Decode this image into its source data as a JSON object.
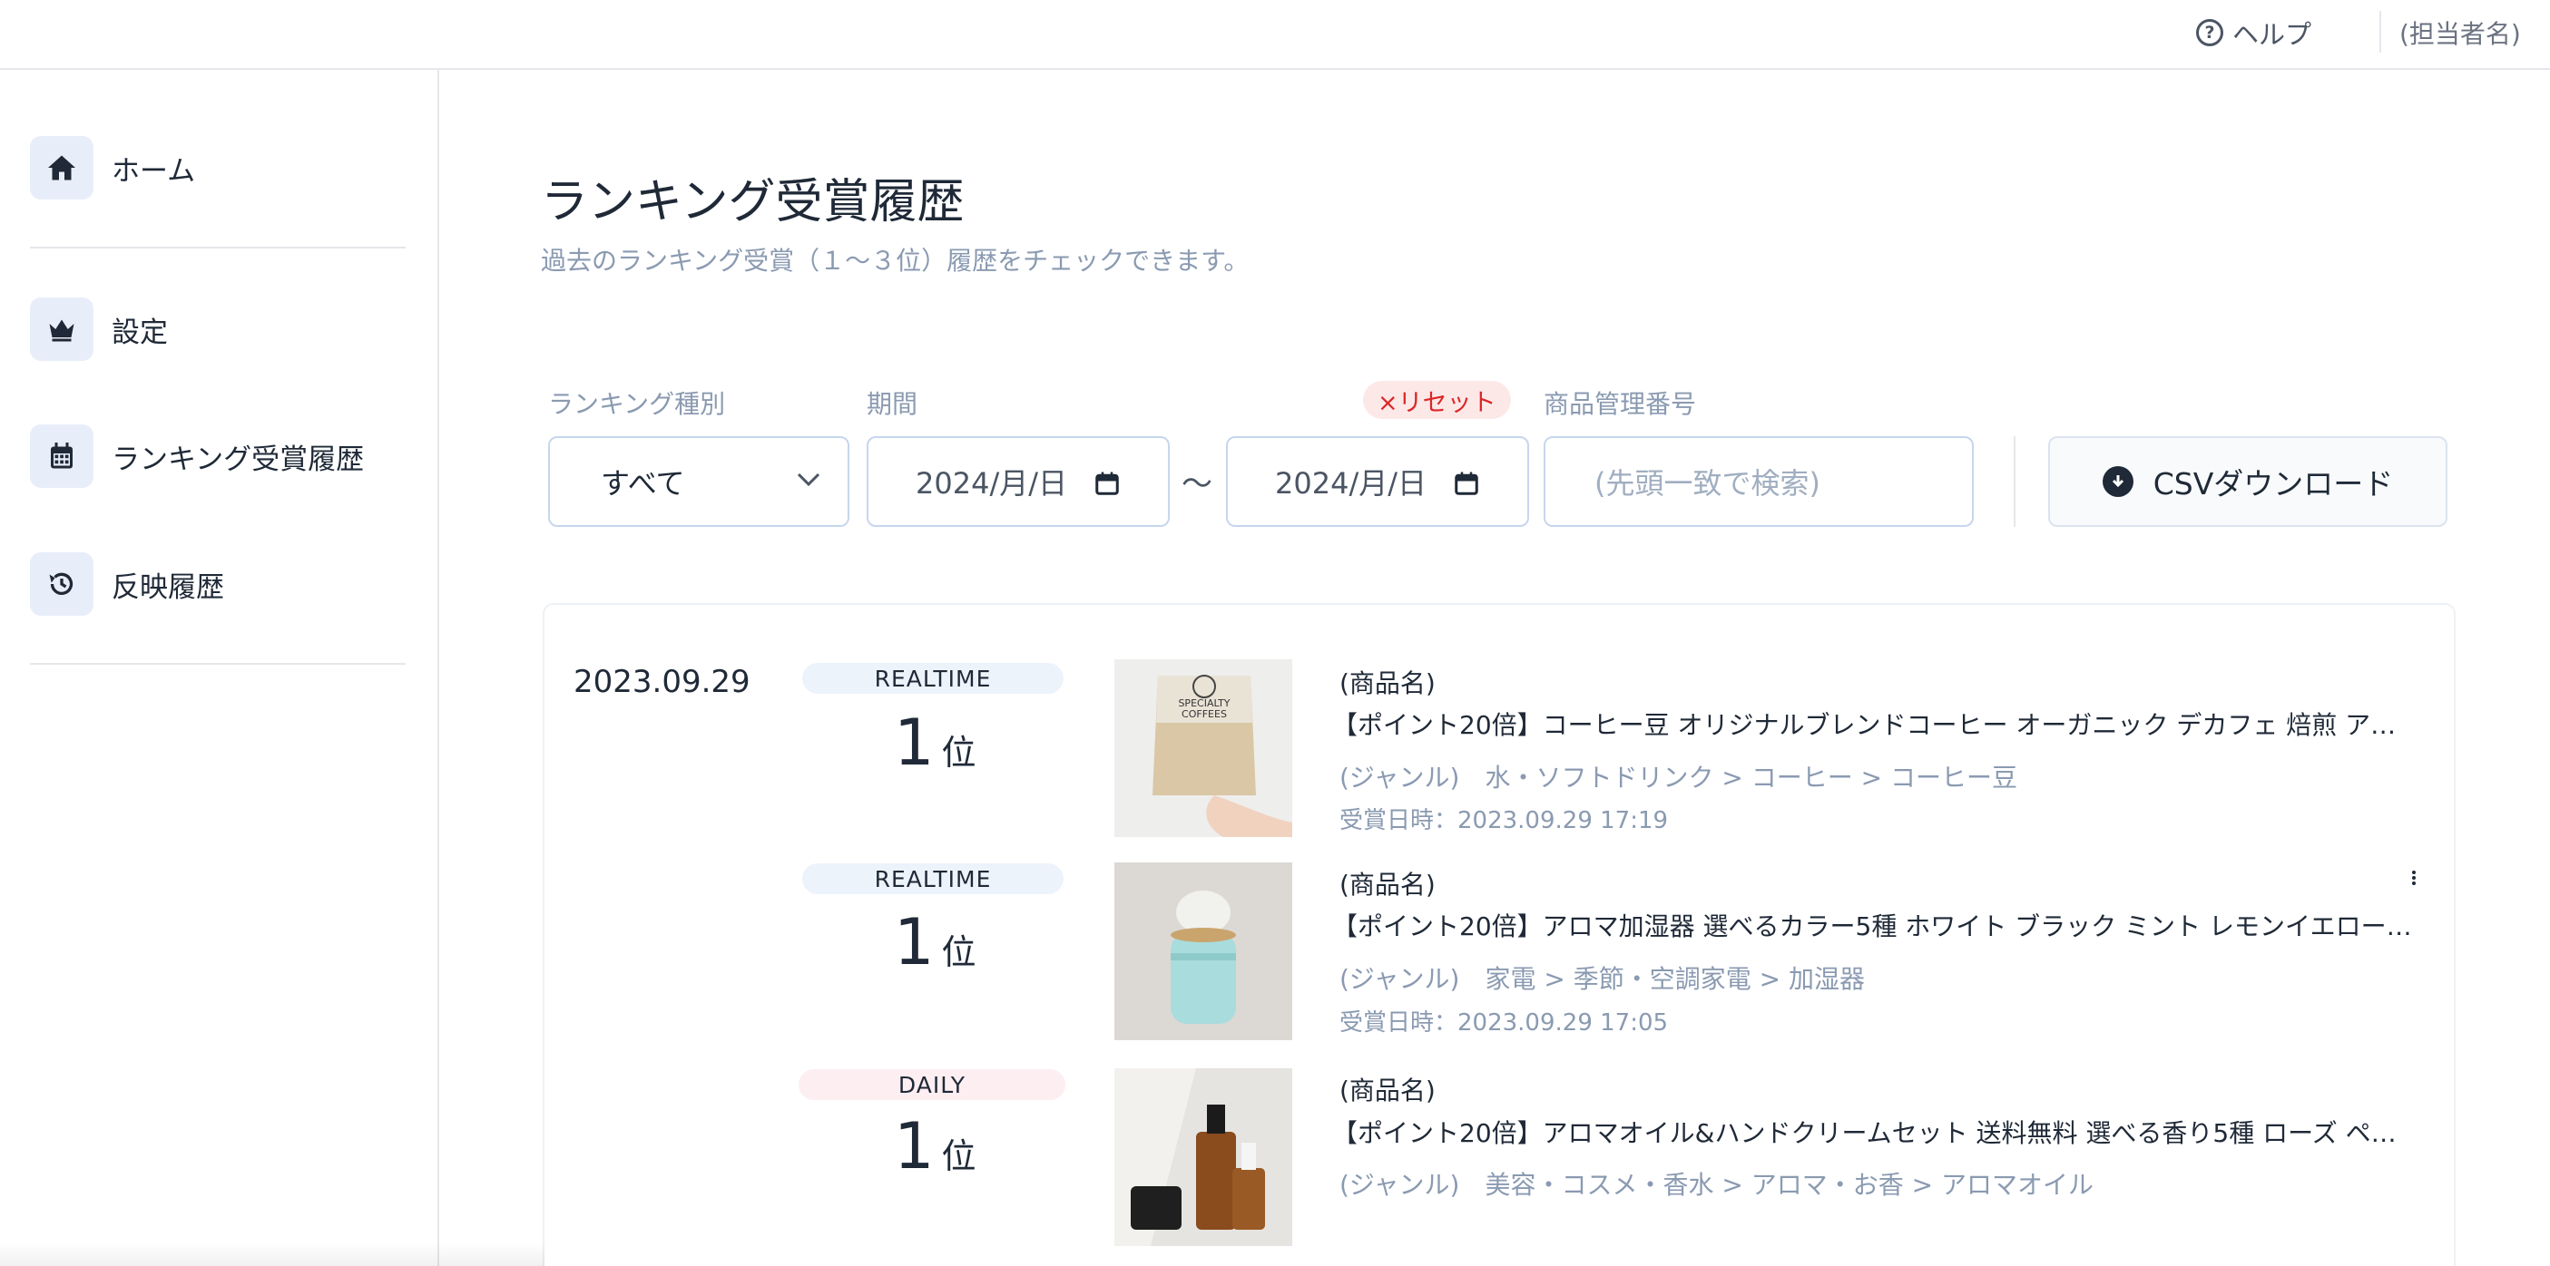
{
  "header": {
    "help_label": "ヘルプ",
    "help_icon_glyph": "?",
    "user_name": "(担当者名)"
  },
  "sidebar": {
    "items": [
      {
        "label": "ホーム",
        "icon": "home-icon"
      },
      {
        "label": "設定",
        "icon": "crown-icon"
      },
      {
        "label": "ランキング受賞履歴",
        "icon": "calendar-icon"
      },
      {
        "label": "反映履歴",
        "icon": "history-icon"
      }
    ]
  },
  "page": {
    "title": "ランキング受賞履歴",
    "subtitle": "過去のランキング受賞（１～３位）履歴をチェックできます。"
  },
  "filters": {
    "type_label": "ランキング種別",
    "type_value": "すべて",
    "period_label": "期間",
    "reset_label": "×リセット",
    "date_from": "2024/月/日",
    "tilde": "～",
    "date_to": "2024/月/日",
    "product_id_label": "商品管理番号",
    "product_id_placeholder": "(先頭一致で検索)",
    "csv_label": "CSVダウンロード"
  },
  "results": {
    "date": "2023.09.29",
    "rank_unit": "位",
    "items": [
      {
        "type": "REALTIME",
        "rank": "1",
        "product_label": "(商品名)",
        "product_name": "【ポイント20倍】コーヒー豆 オリジナルブレンドコーヒー オーガニック デカフェ 焙煎 アロマ…",
        "genre": "(ジャンル)　水・ソフトドリンク > コーヒー > コーヒー豆",
        "award_date": "受賞日時：2023.09.29 17:19",
        "bag_text_1": "SPECIALTY",
        "bag_text_2": "COFFEES"
      },
      {
        "type": "REALTIME",
        "rank": "1",
        "product_label": "(商品名)",
        "product_name": "【ポイント20倍】アロマ加湿器 選べるカラー5種 ホワイト ブラック ミント レモンイエロー …",
        "genre": "(ジャンル)　家電 > 季節・空調家電 > 加湿器",
        "award_date": "受賞日時：2023.09.29 17:05"
      },
      {
        "type": "DAILY",
        "rank": "1",
        "product_label": "(商品名)",
        "product_name": "【ポイント20倍】アロマオイル&ハンドクリームセット 送料無料 選べる香り5種 ローズ ペパー…",
        "genre": "(ジャンル)　美容・コスメ・香水 > アロマ・お香 > アロマオイル"
      }
    ]
  },
  "colors": {
    "accent_icon_bg": "#e8eef9",
    "realtime_badge": "#edf3fb",
    "daily_badge": "#fdeef1",
    "reset_text": "#dc2626"
  }
}
